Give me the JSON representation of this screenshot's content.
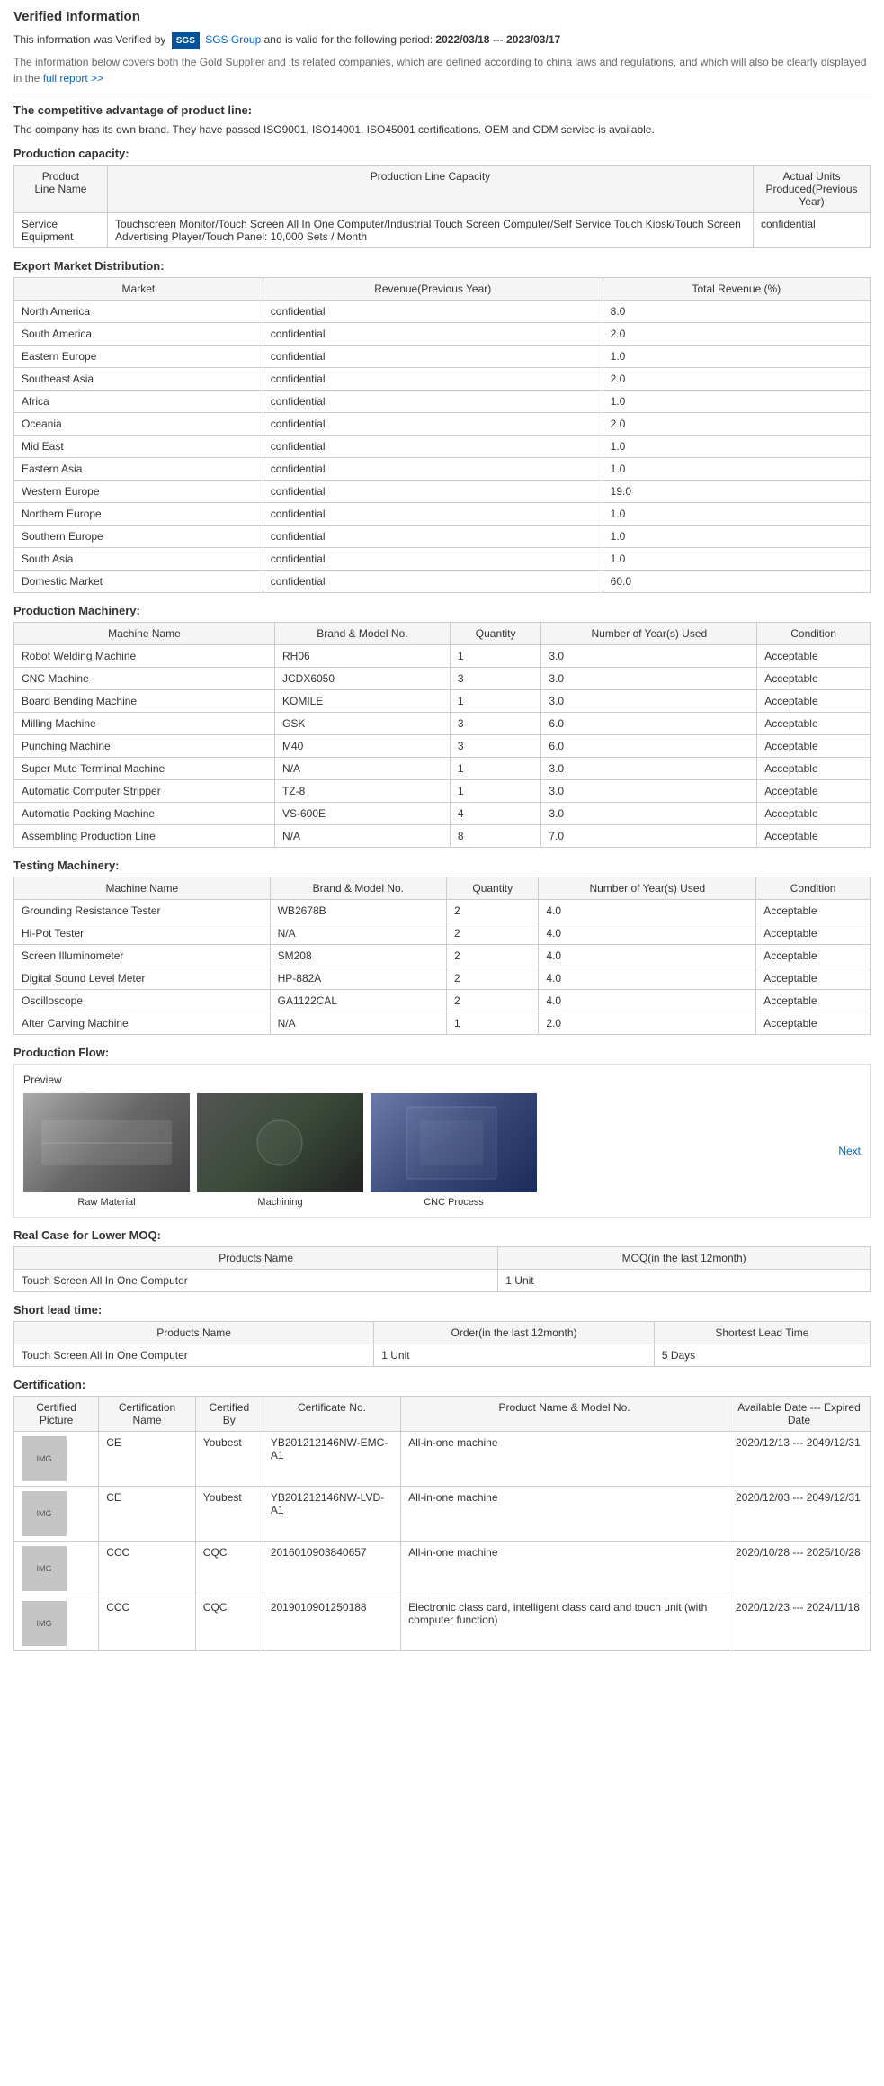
{
  "page": {
    "verified_title": "Verified Information",
    "verified_line1_pre": "This information was Verified by",
    "verified_line1_sgs": "SGS",
    "verified_line1_sgs_link": "SGS Group",
    "verified_line1_post": "and is valid for the following period:",
    "verified_period": "2022/03/18 --- 2023/03/17",
    "verified_line2": "The information below covers both the Gold Supplier and its related companies, which are defined according to china laws and regulations, and which will also be clearly displayed in the",
    "verified_line2_link": "full report >>",
    "competitive_title": "The competitive advantage of product line:",
    "competitive_text": "The company has its own brand. They have passed ISO9001, ISO14001, ISO45001 certifications. OEM and ODM service is available.",
    "production_capacity_title": "Production capacity:",
    "capacity_table": {
      "headers": [
        "Product Line Name",
        "Production Line Capacity",
        "Actual Units Produced(Previous Year)"
      ],
      "rows": [
        {
          "name": "Service Equipment",
          "capacity": "Touchscreen Monitor/Touch Screen All In One Computer/Industrial Touch Screen Computer/Self Service Touch Kiosk/Touch Screen Advertising Player/Touch Panel: 10,000 Sets / Month",
          "units": "confidential"
        }
      ]
    },
    "export_title": "Export Market Distribution:",
    "export_table": {
      "headers": [
        "Market",
        "Revenue(Previous Year)",
        "Total Revenue (%)"
      ],
      "rows": [
        {
          "market": "North America",
          "revenue": "confidential",
          "total": "8.0"
        },
        {
          "market": "South America",
          "revenue": "confidential",
          "total": "2.0"
        },
        {
          "market": "Eastern Europe",
          "revenue": "confidential",
          "total": "1.0"
        },
        {
          "market": "Southeast Asia",
          "revenue": "confidential",
          "total": "2.0"
        },
        {
          "market": "Africa",
          "revenue": "confidential",
          "total": "1.0"
        },
        {
          "market": "Oceania",
          "revenue": "confidential",
          "total": "2.0"
        },
        {
          "market": "Mid East",
          "revenue": "confidential",
          "total": "1.0"
        },
        {
          "market": "Eastern Asia",
          "revenue": "confidential",
          "total": "1.0"
        },
        {
          "market": "Western Europe",
          "revenue": "confidential",
          "total": "19.0"
        },
        {
          "market": "Northern Europe",
          "revenue": "confidential",
          "total": "1.0"
        },
        {
          "market": "Southern Europe",
          "revenue": "confidential",
          "total": "1.0"
        },
        {
          "market": "South Asia",
          "revenue": "confidential",
          "total": "1.0"
        },
        {
          "market": "Domestic Market",
          "revenue": "confidential",
          "total": "60.0"
        }
      ]
    },
    "production_machinery_title": "Production Machinery:",
    "production_table": {
      "headers": [
        "Machine Name",
        "Brand & Model No.",
        "Quantity",
        "Number of Year(s) Used",
        "Condition"
      ],
      "rows": [
        {
          "name": "Robot Welding Machine",
          "brand": "RH06",
          "qty": "1",
          "years": "3.0",
          "condition": "Acceptable"
        },
        {
          "name": "CNC Machine",
          "brand": "JCDX6050",
          "qty": "3",
          "years": "3.0",
          "condition": "Acceptable"
        },
        {
          "name": "Board Bending Machine",
          "brand": "KOMILE",
          "qty": "1",
          "years": "3.0",
          "condition": "Acceptable"
        },
        {
          "name": "Milling Machine",
          "brand": "GSK",
          "qty": "3",
          "years": "6.0",
          "condition": "Acceptable"
        },
        {
          "name": "Punching Machine",
          "brand": "M40",
          "qty": "3",
          "years": "6.0",
          "condition": "Acceptable"
        },
        {
          "name": "Super Mute Terminal Machine",
          "brand": "N/A",
          "qty": "1",
          "years": "3.0",
          "condition": "Acceptable"
        },
        {
          "name": "Automatic Computer Stripper",
          "brand": "TZ-8",
          "qty": "1",
          "years": "3.0",
          "condition": "Acceptable"
        },
        {
          "name": "Automatic Packing Machine",
          "brand": "VS-600E",
          "qty": "4",
          "years": "3.0",
          "condition": "Acceptable"
        },
        {
          "name": "Assembling Production Line",
          "brand": "N/A",
          "qty": "8",
          "years": "7.0",
          "condition": "Acceptable"
        }
      ]
    },
    "testing_machinery_title": "Testing Machinery:",
    "testing_table": {
      "headers": [
        "Machine Name",
        "Brand & Model No.",
        "Quantity",
        "Number of Year(s) Used",
        "Condition"
      ],
      "rows": [
        {
          "name": "Grounding Resistance Tester",
          "brand": "WB2678B",
          "qty": "2",
          "years": "4.0",
          "condition": "Acceptable"
        },
        {
          "name": "Hi-Pot Tester",
          "brand": "N/A",
          "qty": "2",
          "years": "4.0",
          "condition": "Acceptable"
        },
        {
          "name": "Screen Illuminometer",
          "brand": "SM208",
          "qty": "2",
          "years": "4.0",
          "condition": "Acceptable"
        },
        {
          "name": "Digital Sound Level Meter",
          "brand": "HP-882A",
          "qty": "2",
          "years": "4.0",
          "condition": "Acceptable"
        },
        {
          "name": "Oscilloscope",
          "brand": "GA1122CAL",
          "qty": "2",
          "years": "4.0",
          "condition": "Acceptable"
        },
        {
          "name": "After Carving Machine",
          "brand": "N/A",
          "qty": "1",
          "years": "2.0",
          "condition": "Acceptable"
        }
      ]
    },
    "production_flow_title": "Production Flow:",
    "preview_label": "Preview",
    "next_label": "Next",
    "flow_images": [
      {
        "label": "Raw Material",
        "color": "#7a7a7a"
      },
      {
        "label": "Machining",
        "color": "#4a5a4a"
      },
      {
        "label": "CNC Process",
        "color": "#3a4a6a"
      }
    ],
    "moq_title": "Real Case for Lower MOQ:",
    "moq_table": {
      "headers": [
        "Products Name",
        "MOQ(in the last 12month)"
      ],
      "rows": [
        {
          "name": "Touch Screen All In One Computer",
          "moq": "1 Unit"
        }
      ]
    },
    "lead_title": "Short lead time:",
    "lead_table": {
      "headers": [
        "Products Name",
        "Order(in the last 12month)",
        "Shortest Lead Time"
      ],
      "rows": [
        {
          "name": "Touch Screen All In One Computer",
          "order": "1 Unit",
          "lead": "5 Days"
        }
      ]
    },
    "cert_title": "Certification:",
    "cert_table": {
      "headers": [
        "Certified Picture",
        "Certification Name",
        "Certified By",
        "Certificate No.",
        "Product Name & Model No.",
        "Available Date --- Expired Date"
      ],
      "rows": [
        {
          "cert_name": "CE",
          "certified_by": "Youbest",
          "cert_no": "YB201212146NW-EMC-A1",
          "product": "All-in-one machine",
          "dates": "2020/12/13 --- 2049/12/31"
        },
        {
          "cert_name": "CE",
          "certified_by": "Youbest",
          "cert_no": "YB201212146NW-LVD-A1",
          "product": "All-in-one machine",
          "dates": "2020/12/03 --- 2049/12/31"
        },
        {
          "cert_name": "CCC",
          "certified_by": "CQC",
          "cert_no": "2016010903840657",
          "product": "All-in-one machine",
          "dates": "2020/10/28 --- 2025/10/28"
        },
        {
          "cert_name": "CCC",
          "certified_by": "CQC",
          "cert_no": "2019010901250188",
          "product": "Electronic class card, intelligent class card and touch unit (with computer function)",
          "dates": "2020/12/23 --- 2024/11/18"
        }
      ]
    }
  }
}
